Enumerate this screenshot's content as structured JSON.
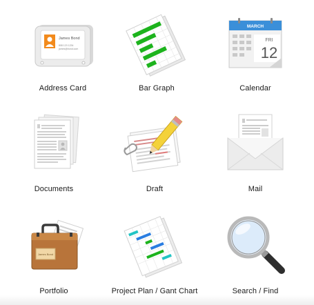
{
  "icons": [
    {
      "label": "Address Card",
      "card_name": "James Bond",
      "card_phone": "808 123 1234",
      "card_email": "james@bond.com"
    },
    {
      "label": "Bar Graph"
    },
    {
      "label": "Calendar",
      "month": "MARCH",
      "weekday": "FRI",
      "day": "12"
    },
    {
      "label": "Documents"
    },
    {
      "label": "Draft"
    },
    {
      "label": "Mail"
    },
    {
      "label": "Portfolio",
      "tag_name": "James Bond"
    },
    {
      "label": "Project Plan / Gant Chart"
    },
    {
      "label": "Search / Find"
    }
  ],
  "colors": {
    "green": "#1db31d",
    "calendar_blue": "#3b8fd9",
    "portfolio_brown": "#b8743a",
    "gantt_blue": "#2a7de1",
    "gantt_cyan": "#22c4c4"
  }
}
